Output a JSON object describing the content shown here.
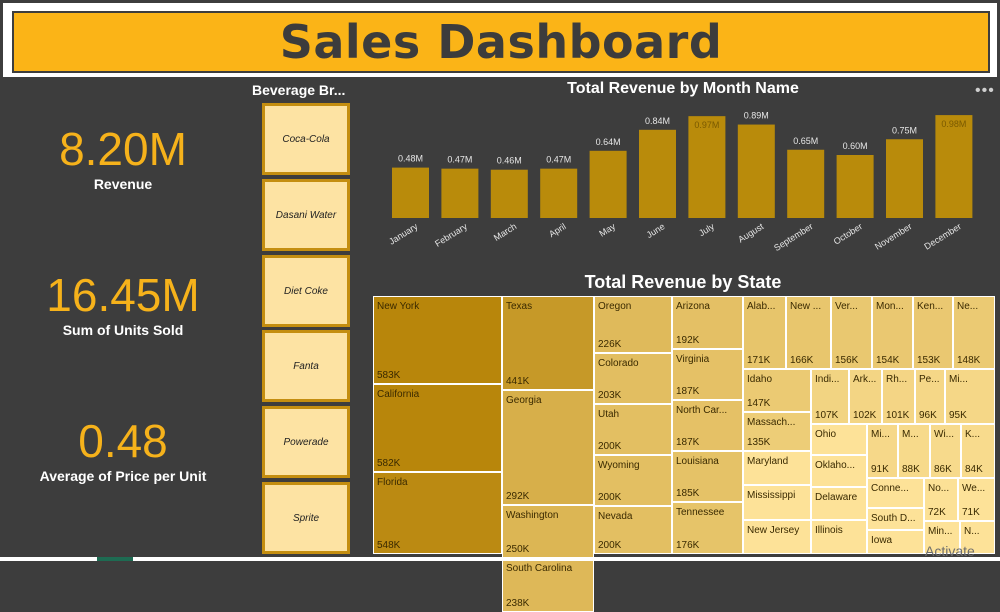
{
  "header": {
    "title": "Sales Dashboard"
  },
  "kpis": [
    {
      "value": "8.20M",
      "label": "Revenue"
    },
    {
      "value": "16.45M",
      "label": "Sum of Units Sold"
    },
    {
      "value": "0.48",
      "label": "Average of Price per Unit"
    }
  ],
  "slicer": {
    "title": "Beverage Br...",
    "items": [
      "Coca-Cola",
      "Dasani Water",
      "Diet Coke",
      "Fanta",
      "Powerade",
      "Sprite"
    ]
  },
  "more_icon": "more-options-icon",
  "watermark": "Activate",
  "colors": {
    "header_bg": "#fbb417",
    "kpi_value": "#f6b21b",
    "bar": "#b98b0b",
    "background": "#3d3d3d"
  },
  "chart_data": [
    {
      "type": "bar",
      "title": "Total Revenue by Month Name",
      "categories": [
        "January",
        "February",
        "March",
        "April",
        "May",
        "June",
        "July",
        "August",
        "September",
        "October",
        "November",
        "December"
      ],
      "values": [
        0.48,
        0.47,
        0.46,
        0.47,
        0.64,
        0.84,
        0.97,
        0.89,
        0.65,
        0.6,
        0.75,
        0.98
      ],
      "data_labels": [
        "0.48M",
        "0.47M",
        "0.46M",
        "0.47M",
        "0.64M",
        "0.84M",
        "0.97M",
        "0.89M",
        "0.65M",
        "0.60M",
        "0.75M",
        "0.98M"
      ],
      "ylim": [
        0,
        1.0
      ],
      "grid": false
    },
    {
      "type": "treemap",
      "title": "Total Revenue by State",
      "items": [
        {
          "name": "New York",
          "label": "583K",
          "value": 583
        },
        {
          "name": "California",
          "label": "582K",
          "value": 582
        },
        {
          "name": "Florida",
          "label": "548K",
          "value": 548
        },
        {
          "name": "Texas",
          "label": "441K",
          "value": 441
        },
        {
          "name": "Georgia",
          "label": "292K",
          "value": 292
        },
        {
          "name": "Washington",
          "label": "250K",
          "value": 250
        },
        {
          "name": "South Carolina",
          "label": "238K",
          "value": 238
        },
        {
          "name": "Oregon",
          "label": "226K",
          "value": 226
        },
        {
          "name": "Colorado",
          "label": "203K",
          "value": 203
        },
        {
          "name": "Utah",
          "label": "200K",
          "value": 200
        },
        {
          "name": "Wyoming",
          "label": "200K",
          "value": 200
        },
        {
          "name": "Nevada",
          "label": "200K",
          "value": 200
        },
        {
          "name": "Arizona",
          "label": "192K",
          "value": 192
        },
        {
          "name": "Virginia",
          "label": "187K",
          "value": 187
        },
        {
          "name": "North Car...",
          "label": "187K",
          "value": 187
        },
        {
          "name": "Louisiana",
          "label": "185K",
          "value": 185
        },
        {
          "name": "Tennessee",
          "label": "176K",
          "value": 176
        },
        {
          "name": "Alab...",
          "label": "171K",
          "value": 171
        },
        {
          "name": "New ...",
          "label": "166K",
          "value": 166
        },
        {
          "name": "Ver...",
          "label": "156K",
          "value": 156
        },
        {
          "name": "Mon...",
          "label": "154K",
          "value": 154
        },
        {
          "name": "Ken...",
          "label": "153K",
          "value": 153
        },
        {
          "name": "Ne...",
          "label": "148K",
          "value": 148
        },
        {
          "name": "Idaho",
          "label": "147K",
          "value": 147
        },
        {
          "name": "Massach...",
          "label": "135K",
          "value": 135
        },
        {
          "name": "Maryland",
          "label": "",
          "value": null
        },
        {
          "name": "Mississippi",
          "label": "",
          "value": null
        },
        {
          "name": "New Jersey",
          "label": "",
          "value": null
        },
        {
          "name": "Indi...",
          "label": "107K",
          "value": 107
        },
        {
          "name": "Ark...",
          "label": "102K",
          "value": 102
        },
        {
          "name": "Rh...",
          "label": "101K",
          "value": 101
        },
        {
          "name": "Pe...",
          "label": "96K",
          "value": 96
        },
        {
          "name": "Mi...",
          "label": "95K",
          "value": 95
        },
        {
          "name": "Ohio",
          "label": "",
          "value": null
        },
        {
          "name": "Mi...",
          "label": "91K",
          "value": 91
        },
        {
          "name": "M...",
          "label": "88K",
          "value": 88
        },
        {
          "name": "Wi...",
          "label": "86K",
          "value": 86
        },
        {
          "name": "K...",
          "label": "84K",
          "value": 84
        },
        {
          "name": "Oklaho...",
          "label": "",
          "value": null
        },
        {
          "name": "Delaware",
          "label": "",
          "value": null
        },
        {
          "name": "Illinois",
          "label": "",
          "value": null
        },
        {
          "name": "Conne...",
          "label": "",
          "value": null
        },
        {
          "name": "No...",
          "label": "72K",
          "value": 72
        },
        {
          "name": "We...",
          "label": "71K",
          "value": 71
        },
        {
          "name": "South D...",
          "label": "",
          "value": null
        },
        {
          "name": "Iowa",
          "label": "",
          "value": null
        },
        {
          "name": "Min...",
          "label": "",
          "value": null
        },
        {
          "name": "N...",
          "label": "",
          "value": null
        }
      ]
    }
  ]
}
